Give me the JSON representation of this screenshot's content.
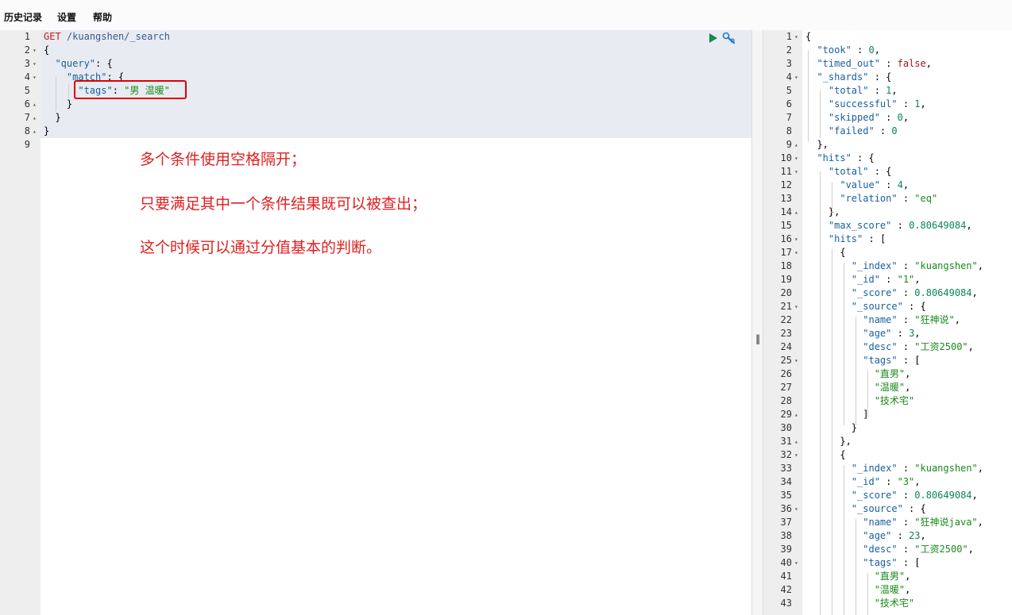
{
  "menu": {
    "history": "历史记录",
    "settings": "设置",
    "help": "帮助"
  },
  "request": {
    "lines": [
      {
        "n": "1",
        "fold": "",
        "html": "<span class=\"kw\">GET</span> <span class=\"url\">/kuangshen/_search</span>"
      },
      {
        "n": "2",
        "fold": "▾",
        "html": "<span class=\"punc\">{</span>"
      },
      {
        "n": "3",
        "fold": "▾",
        "html": "  <span class=\"key\">\"query\"</span><span class=\"punc\">: {</span>"
      },
      {
        "n": "4",
        "fold": "▾",
        "html": "    <span class=\"key\">\"match\"</span><span class=\"punc\">: {</span>"
      },
      {
        "n": "5",
        "fold": "",
        "html": "      <span class=\"key\">\"tags\"</span><span class=\"punc\">: </span><span class=\"str\">\"男 温暖\"</span>"
      },
      {
        "n": "6",
        "fold": "▴",
        "html": "    <span class=\"punc\">}</span>"
      },
      {
        "n": "7",
        "fold": "▴",
        "html": "  <span class=\"punc\">}</span>"
      },
      {
        "n": "8",
        "fold": "▴",
        "html": "<span class=\"punc\">}</span>"
      },
      {
        "n": "9",
        "fold": "",
        "html": ""
      }
    ]
  },
  "annotations": [
    "多个条件使用空格隔开；",
    "只要满足其中一个条件结果既可以被查出；",
    "这个时候可以通过分值基本的判断。"
  ],
  "response": {
    "lines": [
      {
        "n": "1",
        "fold": "▾",
        "html": "<span class=\"punc\">{</span>"
      },
      {
        "n": "2",
        "fold": "",
        "html": "  <span class=\"key\">\"took\"</span> : <span class=\"num\">0</span>,"
      },
      {
        "n": "3",
        "fold": "",
        "html": "  <span class=\"key\">\"timed_out\"</span> : <span class=\"bool\">false</span>,"
      },
      {
        "n": "4",
        "fold": "▾",
        "html": "  <span class=\"key\">\"_shards\"</span> : {"
      },
      {
        "n": "5",
        "fold": "",
        "html": "    <span class=\"key\">\"total\"</span> : <span class=\"num\">1</span>,"
      },
      {
        "n": "6",
        "fold": "",
        "html": "    <span class=\"key\">\"successful\"</span> : <span class=\"num\">1</span>,"
      },
      {
        "n": "7",
        "fold": "",
        "html": "    <span class=\"key\">\"skipped\"</span> : <span class=\"num\">0</span>,"
      },
      {
        "n": "8",
        "fold": "",
        "html": "    <span class=\"key\">\"failed\"</span> : <span class=\"num\">0</span>"
      },
      {
        "n": "9",
        "fold": "▴",
        "html": "  },"
      },
      {
        "n": "10",
        "fold": "▾",
        "html": "  <span class=\"key\">\"hits\"</span> : {"
      },
      {
        "n": "11",
        "fold": "▾",
        "html": "    <span class=\"key\">\"total\"</span> : {"
      },
      {
        "n": "12",
        "fold": "",
        "html": "      <span class=\"key\">\"value\"</span> : <span class=\"num\">4</span>,"
      },
      {
        "n": "13",
        "fold": "",
        "html": "      <span class=\"key\">\"relation\"</span> : <span class=\"str\">\"eq\"</span>"
      },
      {
        "n": "14",
        "fold": "▴",
        "html": "    },"
      },
      {
        "n": "15",
        "fold": "",
        "html": "    <span class=\"key\">\"max_score\"</span> : <span class=\"num\">0.80649084</span>,"
      },
      {
        "n": "16",
        "fold": "▾",
        "html": "    <span class=\"key\">\"hits\"</span> : ["
      },
      {
        "n": "17",
        "fold": "▾",
        "html": "      {"
      },
      {
        "n": "18",
        "fold": "",
        "html": "        <span class=\"key\">\"_index\"</span> : <span class=\"str\">\"kuangshen\"</span>,"
      },
      {
        "n": "19",
        "fold": "",
        "html": "        <span class=\"key\">\"_id\"</span> : <span class=\"str\">\"1\"</span>,"
      },
      {
        "n": "20",
        "fold": "",
        "html": "        <span class=\"key\">\"_score\"</span> : <span class=\"num\">0.80649084</span>,"
      },
      {
        "n": "21",
        "fold": "▾",
        "html": "        <span class=\"key\">\"_source\"</span> : {"
      },
      {
        "n": "22",
        "fold": "",
        "html": "          <span class=\"key\">\"name\"</span> : <span class=\"str\">\"狂神说\"</span>,"
      },
      {
        "n": "23",
        "fold": "",
        "html": "          <span class=\"key\">\"age\"</span> : <span class=\"num\">3</span>,"
      },
      {
        "n": "24",
        "fold": "",
        "html": "          <span class=\"key\">\"desc\"</span> : <span class=\"str\">\"工资2500\"</span>,"
      },
      {
        "n": "25",
        "fold": "▾",
        "html": "          <span class=\"key\">\"tags\"</span> : ["
      },
      {
        "n": "26",
        "fold": "",
        "html": "            <span class=\"str\">\"直男\"</span>,"
      },
      {
        "n": "27",
        "fold": "",
        "html": "            <span class=\"str\">\"温暖\"</span>,"
      },
      {
        "n": "28",
        "fold": "",
        "html": "            <span class=\"str\">\"技术宅\"</span>"
      },
      {
        "n": "29",
        "fold": "▴",
        "html": "          ]"
      },
      {
        "n": "30",
        "fold": "",
        "html": "        }"
      },
      {
        "n": "31",
        "fold": "▴",
        "html": "      },"
      },
      {
        "n": "32",
        "fold": "▾",
        "html": "      {"
      },
      {
        "n": "33",
        "fold": "",
        "html": "        <span class=\"key\">\"_index\"</span> : <span class=\"str\">\"kuangshen\"</span>,"
      },
      {
        "n": "34",
        "fold": "",
        "html": "        <span class=\"key\">\"_id\"</span> : <span class=\"str\">\"3\"</span>,"
      },
      {
        "n": "35",
        "fold": "",
        "html": "        <span class=\"key\">\"_score\"</span> : <span class=\"num\">0.80649084</span>,"
      },
      {
        "n": "36",
        "fold": "▾",
        "html": "        <span class=\"key\">\"_source\"</span> : {"
      },
      {
        "n": "37",
        "fold": "",
        "html": "          <span class=\"key\">\"name\"</span> : <span class=\"str\">\"狂神说java\"</span>,"
      },
      {
        "n": "38",
        "fold": "",
        "html": "          <span class=\"key\">\"age\"</span> : <span class=\"num\">23</span>,"
      },
      {
        "n": "39",
        "fold": "",
        "html": "          <span class=\"key\">\"desc\"</span> : <span class=\"str\">\"工资2500\"</span>,"
      },
      {
        "n": "40",
        "fold": "▾",
        "html": "          <span class=\"key\">\"tags\"</span> : ["
      },
      {
        "n": "41",
        "fold": "",
        "html": "            <span class=\"str\">\"直男\"</span>,"
      },
      {
        "n": "42",
        "fold": "",
        "html": "            <span class=\"str\">\"温暖\"</span>,"
      },
      {
        "n": "43",
        "fold": "",
        "html": "            <span class=\"str\">\"技术宅\"</span>"
      }
    ]
  },
  "colors": {
    "highlight_border": "#e00000",
    "annotation_text": "#e02020",
    "run_button": "#1a8a4a",
    "wrench_icon": "#1a7bd0"
  }
}
